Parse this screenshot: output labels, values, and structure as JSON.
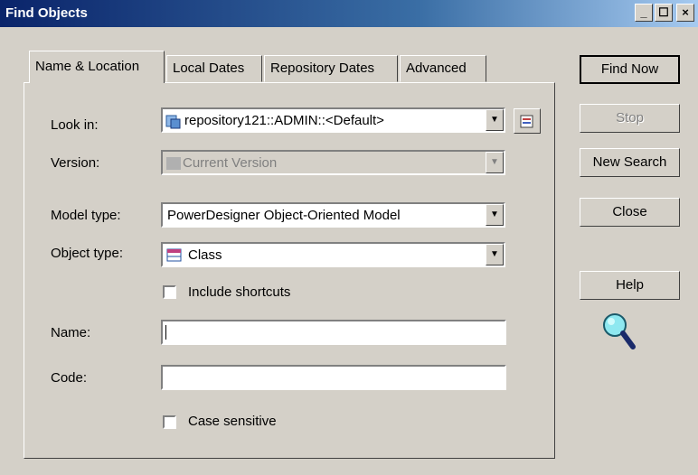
{
  "window": {
    "title": "Find Objects",
    "min": "_",
    "max": "☐",
    "close": "×"
  },
  "tabs": [
    "Name & Location",
    "Local Dates",
    "Repository Dates",
    "Advanced"
  ],
  "form": {
    "look_in_label": "Look in:",
    "look_in_value": "repository121::ADMIN::<Default>",
    "version_label": "Version:",
    "version_value": "Current Version",
    "model_type_label": "Model type:",
    "model_type_value": "PowerDesigner Object-Oriented Model",
    "object_type_label": "Object type:",
    "object_type_value": "Class",
    "include_shortcuts_label": "Include shortcuts",
    "include_shortcuts_checked": false,
    "name_label": "Name:",
    "name_value": "",
    "code_label": "Code:",
    "code_value": "",
    "case_sensitive_label": "Case sensitive",
    "case_sensitive_checked": false
  },
  "buttons": {
    "find_now": "Find Now",
    "stop": "Stop",
    "new_search": "New Search",
    "close": "Close",
    "help": "Help"
  },
  "colors": {
    "title_start": "#0a246a",
    "title_end": "#a6caf0",
    "face": "#d4d0c8"
  }
}
